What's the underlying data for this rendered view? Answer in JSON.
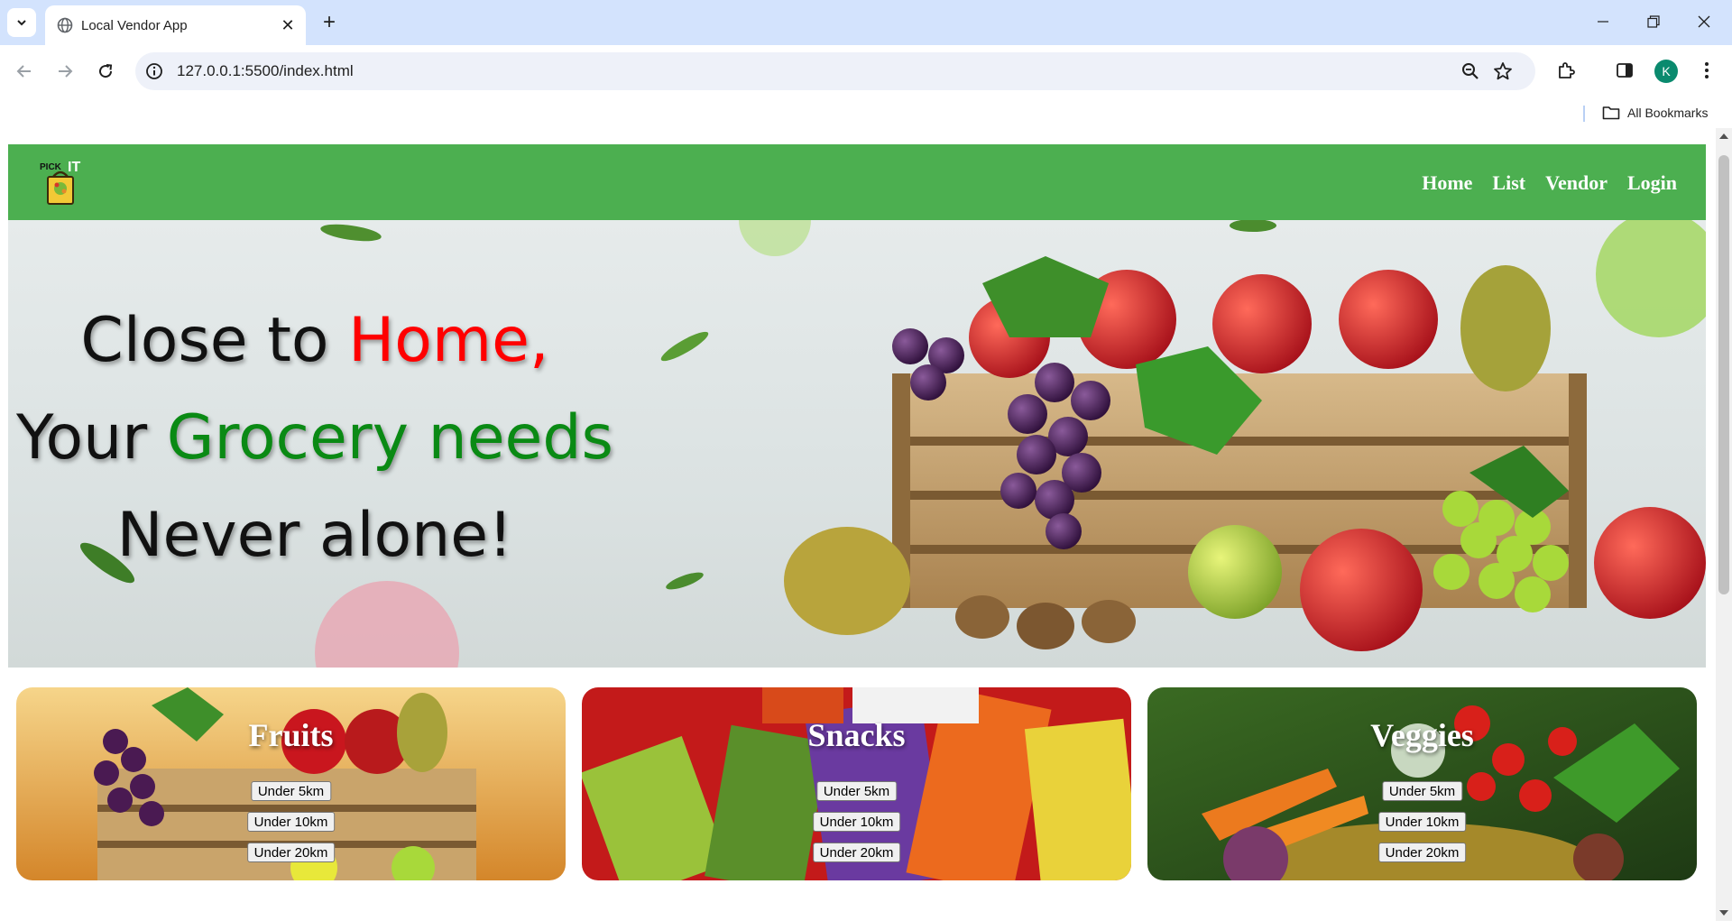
{
  "browser": {
    "tab": {
      "title": "Local Vendor App"
    },
    "address_bar": {
      "url": "127.0.0.1:5500/index.html"
    },
    "profile_initial": "K",
    "bookmarks": {
      "all_bookmarks_label": "All Bookmarks"
    }
  },
  "site": {
    "logo": {
      "text_small": "PICK",
      "text_large": "IT"
    },
    "nav": {
      "home": "Home",
      "list": "List",
      "vendor": "Vendor",
      "login": "Login"
    },
    "hero": {
      "line1_prefix": "Close to ",
      "line1_highlight": "Home,",
      "line2_prefix": "Your ",
      "line2_highlight": "Grocery needs",
      "line3": "Never alone!",
      "colors": {
        "red": "#ff0000",
        "green": "#0a8a14"
      }
    },
    "categories": [
      {
        "title": "Fruits",
        "buttons": [
          "Under 5km",
          "Under 10km",
          "Under 20km"
        ]
      },
      {
        "title": "Snacks",
        "buttons": [
          "Under 5km",
          "Under 10km",
          "Under 20km"
        ]
      },
      {
        "title": "Veggies",
        "buttons": [
          "Under 5km",
          "Under 10km",
          "Under 20km"
        ]
      }
    ],
    "brand_color": "#4caf50"
  }
}
